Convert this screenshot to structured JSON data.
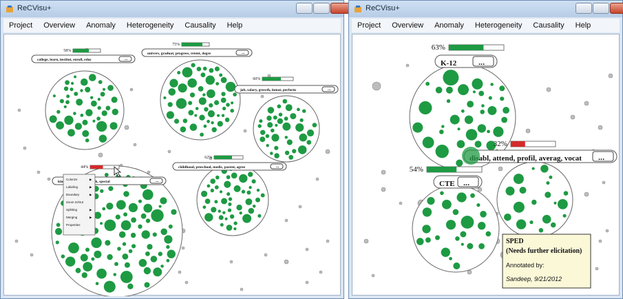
{
  "colors": {
    "green": "#1e9a43",
    "gray": "#bdbdbd",
    "red": "#d42a2a",
    "tooltip_bg": "#fbf8d8"
  },
  "left_window": {
    "title": "ReCVisu+",
    "menu": [
      "Project",
      "Overview",
      "Anomaly",
      "Heterogeneity",
      "Causality",
      "Help"
    ],
    "clusters": [
      {
        "percent": "58%",
        "level": 0.58,
        "keywords": "college, learn, institut, enroll, educ",
        "more": "...",
        "selected": false
      },
      {
        "percent": "75%",
        "level": 0.75,
        "keywords": "univers, graduat, progress, retent, degre",
        "more": "...",
        "selected": false
      },
      {
        "percent": "60%",
        "level": 0.6,
        "keywords": "job, salary, growth, inmat, perform",
        "more": "...",
        "selected": false
      },
      {
        "percent": "44%",
        "level": 0.44,
        "keywords": "kindi, ..., er, career, track, special",
        "more": "...",
        "selected": true
      },
      {
        "percent": "62%",
        "level": 0.62,
        "keywords": "childhood, preschool, medic, parent, agree",
        "more": "...",
        "selected": false
      }
    ],
    "context_menu": [
      "Colorize",
      "Labeling",
      "Boundary",
      "Zoom In/Out",
      "Splitting",
      "Merging",
      "Properties"
    ]
  },
  "right_window": {
    "title": "ReCVisu+",
    "menu": [
      "Project",
      "Overview",
      "Anomaly",
      "Heterogeneity",
      "Causality",
      "Help"
    ],
    "clusters": [
      {
        "percent": "63%",
        "level": 0.63,
        "keywords": "K-12",
        "more": "...",
        "selected": false
      },
      {
        "percent": "32%",
        "level": 0.32,
        "keywords": "disabl, attend, profil, averag, vocat",
        "more": "...",
        "selected": true
      },
      {
        "percent": "54%",
        "level": 0.54,
        "keywords": "CTE",
        "more": "...",
        "selected": false
      }
    ],
    "tooltip": {
      "title": "SPED",
      "subtitle": "(Needs further elicitation)",
      "annotated_label": "Annotated by:",
      "annotator": "Sandeep, 9/21/2012"
    }
  }
}
